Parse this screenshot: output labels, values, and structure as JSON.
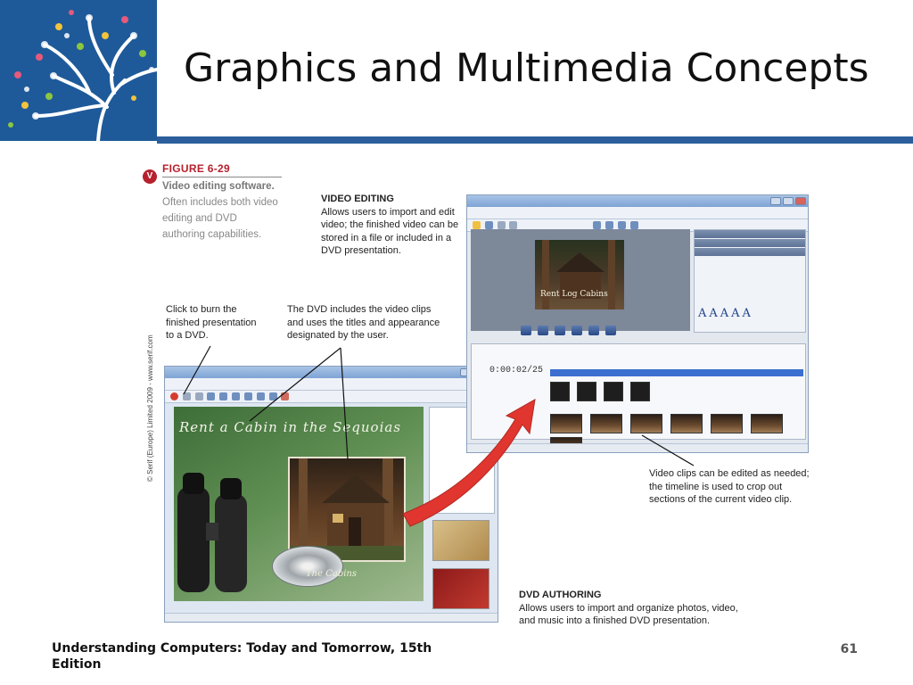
{
  "slide": {
    "title": "Graphics and Multimedia Concepts",
    "footer": "Understanding Computers: Today and Tomorrow, 15th Edition",
    "page_number": "61"
  },
  "figure": {
    "label": "FIGURE 6-29",
    "caption_bold": "Video editing software.",
    "caption_rest": " Often includes both video editing and DVD authoring capabilities.",
    "copyright": "© Serif (Europe) Limited 2009 - www.serif.com"
  },
  "notes": {
    "video_editing_head": "VIDEO EDITING",
    "video_editing_text": "Allows users to import and edit video; the finished video can be stored in a file or included in a DVD presentation.",
    "burn": "Click to burn the finished presentation to a DVD.",
    "dvd_includes": "The DVD includes the video clips and uses the titles and appearance designated by the user.",
    "clips_edit": "Video clips can be edited as needed; the timeline is used to crop out sections of the current video clip.",
    "dvd_authoring_head": "DVD AUTHORING",
    "dvd_authoring_text": "Allows users to import and organize photos, video, and music into a finished DVD presentation."
  },
  "dvd_window": {
    "headline": "Rent a Cabin in the Sequoias",
    "photo_caption": "The Cabins"
  },
  "video_window": {
    "preview_caption": "Rent Log Cabins",
    "time_code": "0:00:02/25"
  },
  "colors": {
    "accent_blue": "#2c5e9c",
    "figure_red": "#b7202d",
    "arrow_red": "#e0362f"
  }
}
